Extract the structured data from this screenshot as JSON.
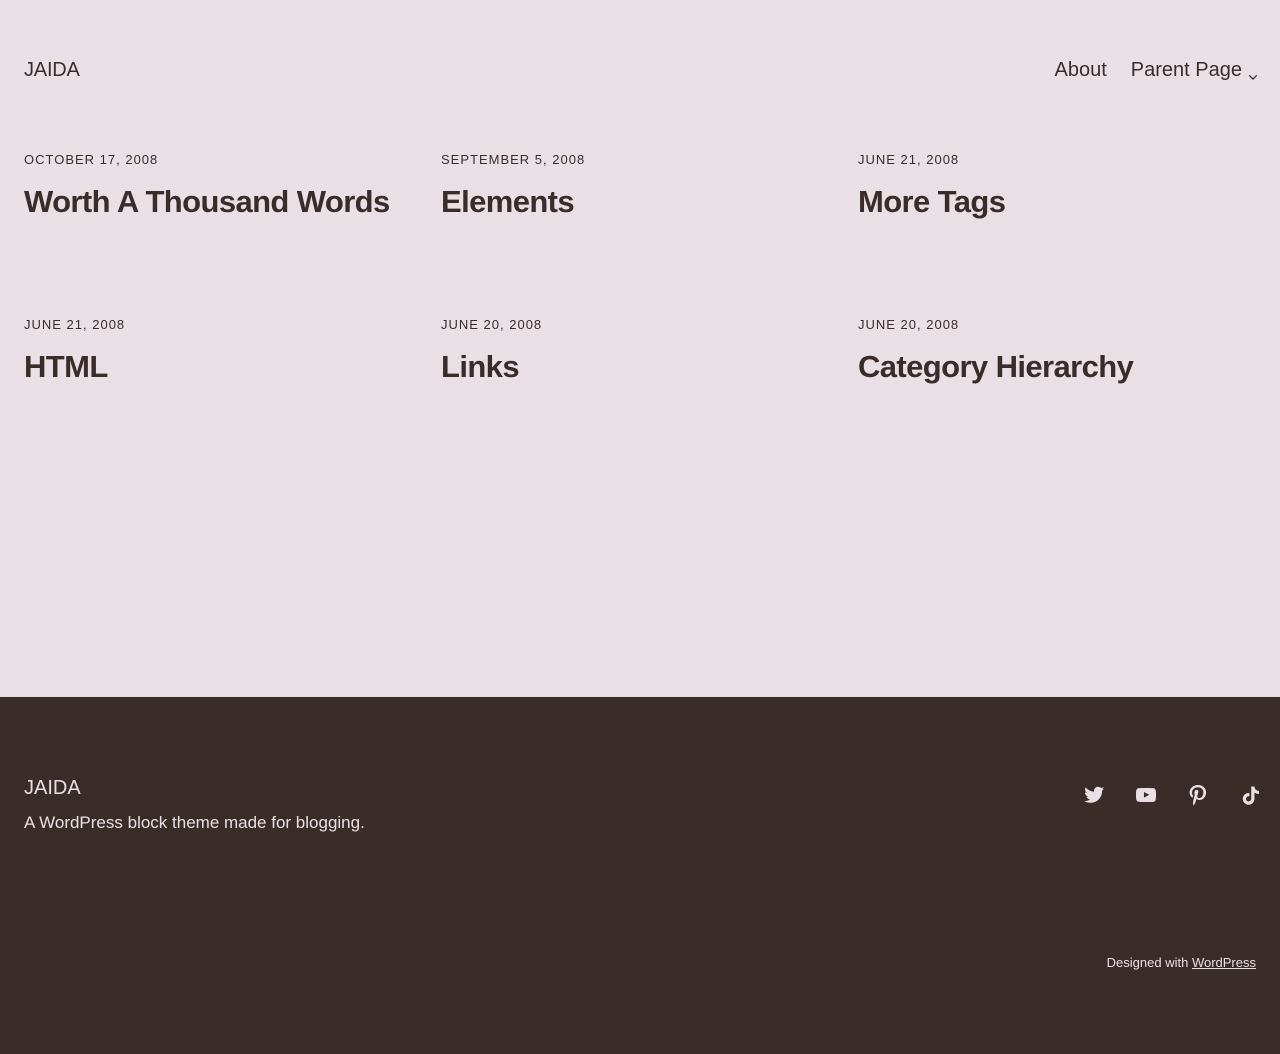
{
  "header": {
    "site_title": "JAIDA",
    "nav": [
      {
        "label": "About"
      },
      {
        "label": "Parent Page",
        "has_submenu": true,
        "submenu_icon": "chevron-down-icon"
      }
    ]
  },
  "posts": [
    {
      "date": "October 17, 2008",
      "title": "Worth A Thousand Words"
    },
    {
      "date": "September 5, 2008",
      "title": "Elements"
    },
    {
      "date": "June 21, 2008",
      "title": "More Tags"
    },
    {
      "date": "June 21, 2008",
      "title": "HTML"
    },
    {
      "date": "June 20, 2008",
      "title": "Links"
    },
    {
      "date": "June 20, 2008",
      "title": "Category Hierarchy"
    }
  ],
  "footer": {
    "site_title": "JAIDA",
    "tagline": "A WordPress block theme made for blogging.",
    "social_icons": [
      "twitter-icon",
      "youtube-icon",
      "pinterest-icon",
      "tiktok-icon"
    ],
    "credit_prefix": "Designed with",
    "credit_link": "WordPress"
  },
  "colors": {
    "background": "#e9e0e5",
    "text": "#3a2c29",
    "footer_background": "#3a2c29",
    "footer_text": "#e9e0e5"
  }
}
